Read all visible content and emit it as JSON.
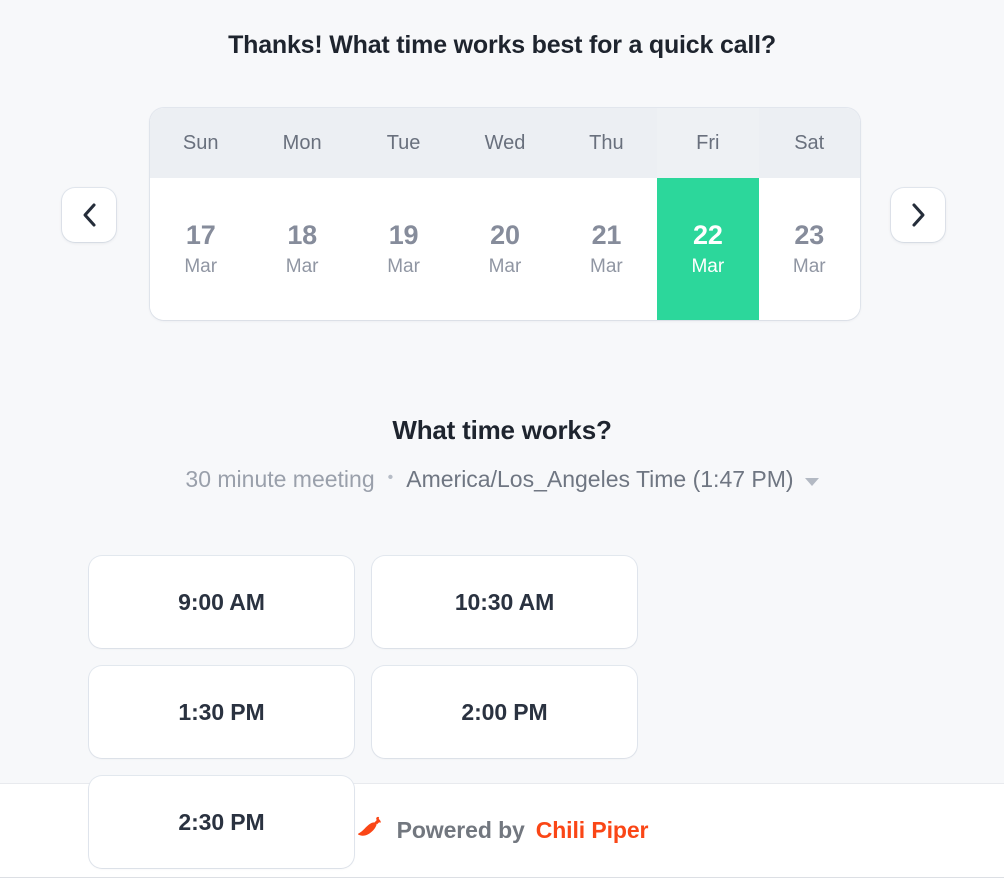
{
  "page": {
    "title": "Thanks! What time works best for a quick call?",
    "background_color": "#f7f8fa"
  },
  "calendar": {
    "prev_icon": "chevron-left-icon",
    "next_icon": "chevron-right-icon",
    "selected_index": 5,
    "selected_color": "#2cd79b",
    "header_background": "#eceff3",
    "days": [
      {
        "dow": "Sun",
        "date": "17",
        "month": "Mar",
        "selected": false
      },
      {
        "dow": "Mon",
        "date": "18",
        "month": "Mar",
        "selected": false
      },
      {
        "dow": "Tue",
        "date": "19",
        "month": "Mar",
        "selected": false
      },
      {
        "dow": "Wed",
        "date": "20",
        "month": "Mar",
        "selected": false
      },
      {
        "dow": "Thu",
        "date": "21",
        "month": "Mar",
        "selected": false
      },
      {
        "dow": "Fri",
        "date": "22",
        "month": "Mar",
        "selected": true
      },
      {
        "dow": "Sat",
        "date": "23",
        "month": "Mar",
        "selected": false
      }
    ]
  },
  "time_picker": {
    "heading": "What time works?",
    "duration": "30 minute meeting",
    "separator": "•",
    "timezone": "America/Los_Angeles Time (1:47 PM)",
    "timezone_caret_icon": "chevron-down-icon",
    "slots": [
      {
        "label": "9:00 AM"
      },
      {
        "label": "10:30 AM"
      },
      {
        "label": "1:30 PM"
      },
      {
        "label": "2:00 PM"
      },
      {
        "label": "2:30 PM"
      }
    ]
  },
  "footer": {
    "icon": "chili-pepper-icon",
    "powered_by": "Powered by",
    "brand": "Chili Piper",
    "brand_color": "#fa4616"
  }
}
